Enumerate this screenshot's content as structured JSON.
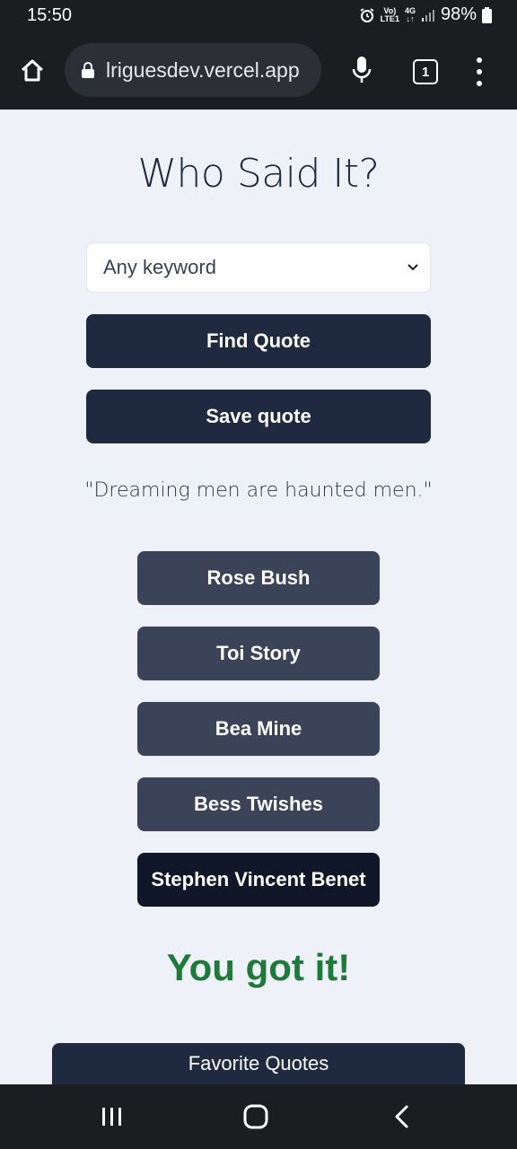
{
  "status_bar": {
    "time": "15:50",
    "network_top": "Vo)",
    "network_bottom": "LTE1",
    "signal_type": "4G",
    "battery": "98%"
  },
  "browser": {
    "url": "lriguesdev.vercel.app",
    "tab_count": "1"
  },
  "page": {
    "title": "Who Said It?",
    "keyword_select": {
      "selected": "Any keyword"
    },
    "find_button": "Find Quote",
    "save_button": "Save quote",
    "quote": "\"Dreaming men are haunted men.\"",
    "choices": [
      {
        "label": "Rose Bush"
      },
      {
        "label": "Toi Story"
      },
      {
        "label": "Bea Mine"
      },
      {
        "label": "Bess Twishes"
      },
      {
        "label": "Stephen Vincent Benet"
      }
    ],
    "result": "You got it!",
    "favorites_button": "Favorite Quotes"
  },
  "colors": {
    "primary_button": "#1f2940",
    "choice_button": "#3a4357",
    "selected_choice": "#0f1728",
    "success": "#1f7a3a",
    "background": "#eef2f8"
  }
}
